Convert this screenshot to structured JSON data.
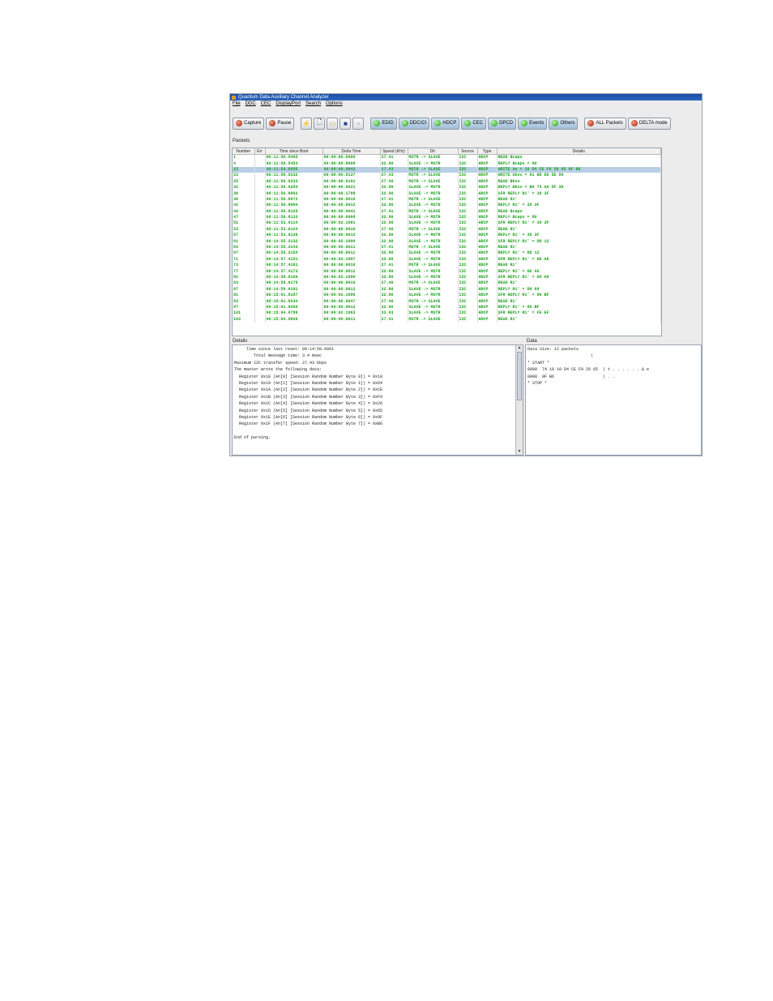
{
  "window": {
    "title": "Quantum Data Auxiliary Channel Analyzer"
  },
  "menu": [
    "File",
    "DDC",
    "CEC",
    "DisplayPort",
    "Search",
    "Options"
  ],
  "toolbar": {
    "capture": "Capture",
    "pause": "Pause",
    "filters": [
      "EDID",
      "DDC/CI",
      "HDCP",
      "CEC",
      "DPCD",
      "Events",
      "Others"
    ],
    "all_packets": "ALL Packets",
    "delta_mode": "DELTA mode"
  },
  "packets": {
    "label": "Packets",
    "columns": [
      "Number",
      "Err",
      "Time since Boot",
      "Delta Time",
      "Speed (kHz)",
      "Dir",
      "Source",
      "Type",
      "Details"
    ],
    "rows": [
      [
        "1",
        "",
        "00:11:50.5465",
        "00:00:00.0000",
        "27.41",
        "MSTR -> SLAVE",
        "I2C",
        "HDCP",
        "READ Bcaps"
      ],
      [
        "4",
        "",
        "00:11:50.5453",
        "00:00:00.0008",
        "32.80",
        "SLAVE -> MSTR",
        "I2C",
        "HDCP",
        "REPLY Bcaps = 80"
      ],
      [
        "15",
        "",
        "00:11:50.6095",
        "00:00:00.0642",
        "27.43",
        "MSTR -> SLAVE",
        "I2C",
        "HDCP",
        "WRITE An = 10 D4 CE F9 26 65 9F B6"
      ],
      [
        "23",
        "",
        "00:11:50.6232",
        "00:00:00.0137",
        "27.43",
        "MSTR -> SLAVE",
        "I2C",
        "HDCP",
        "WRITE Aksv = 61 B8 D0 5E 96"
      ],
      [
        "25",
        "",
        "00:11:50.6233",
        "00:00:00.0101",
        "27.40",
        "MSTR -> SLAVE",
        "I2C",
        "HDCP",
        "READ Bksv"
      ],
      [
        "32",
        "",
        "00:11:50.6254",
        "00:00:00.0021",
        "32.90",
        "SLAVE -> MSTR",
        "I2C",
        "HDCP",
        "REPLY Bksv = B0 75 AA 5F 38"
      ],
      [
        "36",
        "",
        "00:11:50.8062",
        "00:00:00.1798",
        "32.90",
        "SLAVE -> MSTR",
        "I2C",
        "HDCP",
        "SFR REPLY Ri' = 39 3F"
      ],
      [
        "38",
        "",
        "00:11:50.8072",
        "00:00:00.0010",
        "27.41",
        "MSTR -> SLAVE",
        "I2C",
        "HDCP",
        "READ Ri'"
      ],
      [
        "42",
        "",
        "00:11:50.8084",
        "00:00:00.0012",
        "32.90",
        "SLAVE -> MSTR",
        "I2C",
        "HDCP",
        "REPLY Ri' = 39 3F"
      ],
      [
        "44",
        "",
        "00:11:50.8125",
        "00:00:00.0041",
        "27.41",
        "MSTR -> SLAVE",
        "I2C",
        "HDCP",
        "READ Bcaps"
      ],
      [
        "47",
        "",
        "00:11:50.8133",
        "00:00:00.0008",
        "32.90",
        "SLAVE -> MSTR",
        "I2C",
        "HDCP",
        "REPLY Bcaps = 80"
      ],
      [
        "51",
        "",
        "00:11:53.0114",
        "00:00:02.1981",
        "32.90",
        "SLAVE -> MSTR",
        "I2C",
        "HDCP",
        "SFR REPLY Ri' = 39 3F"
      ],
      [
        "53",
        "",
        "00:11:53.0124",
        "00:00:00.0010",
        "27.40",
        "MSTR -> SLAVE",
        "I2C",
        "HDCP",
        "READ Ri'"
      ],
      [
        "57",
        "",
        "00:11:53.0136",
        "00:00:00.0012",
        "32.90",
        "SLAVE -> MSTR",
        "I2C",
        "HDCP",
        "REPLY Ri' = 39 3F"
      ],
      [
        "61",
        "",
        "00:14:55.2132",
        "00:00:02.1996",
        "32.90",
        "SLAVE -> MSTR",
        "I2C",
        "HDCP",
        "SFR REPLY Ri' = DD 12"
      ],
      [
        "63",
        "",
        "00:14:55.2143",
        "00:00:00.0011",
        "27.41",
        "MSTR -> SLAVE",
        "I2C",
        "HDCP",
        "READ Ri'"
      ],
      [
        "67",
        "",
        "00:14:55.2154",
        "00:00:00.0011",
        "32.90",
        "SLAVE -> MSTR",
        "I2C",
        "HDCP",
        "REPLY Ri' = DD 12"
      ],
      [
        "71",
        "",
        "00:14:57.4151",
        "00:00:02.1997",
        "32.80",
        "SLAVE -> MSTR",
        "I2C",
        "HDCP",
        "SFR REPLY Ri' = DE A6"
      ],
      [
        "73",
        "",
        "00:14:57.4161",
        "00:00:00.0010",
        "27.41",
        "MSTR -> SLAVE",
        "I2C",
        "HDCP",
        "READ Ri'"
      ],
      [
        "77",
        "",
        "00:14:57.4173",
        "00:00:00.0012",
        "32.80",
        "SLAVE -> MSTR",
        "I2C",
        "HDCP",
        "REPLY Ri' = DE A6"
      ],
      [
        "81",
        "",
        "00:14:59.6169",
        "00:00:02.1996",
        "32.90",
        "SLAVE -> MSTR",
        "I2C",
        "HDCP",
        "SFR REPLY Ri' = D6 69"
      ],
      [
        "83",
        "",
        "00:14:59.6179",
        "00:00:00.0010",
        "27.40",
        "MSTR -> SLAVE",
        "I2C",
        "HDCP",
        "READ Ri'"
      ],
      [
        "87",
        "",
        "00:14:59.6191",
        "00:00:00.0012",
        "32.80",
        "SLAVE -> MSTR",
        "I2C",
        "HDCP",
        "REPLY Ri' = D6 69"
      ],
      [
        "91",
        "",
        "00:15:01.8187",
        "00:00:02.1996",
        "32.90",
        "SLAVE -> MSTR",
        "I2C",
        "HDCP",
        "SFR REPLY Ri' = 86 BF"
      ],
      [
        "93",
        "",
        "00:15:01.8234",
        "00:00:00.0047",
        "27.40",
        "MSTR -> SLAVE",
        "I2C",
        "HDCP",
        "READ Ri'"
      ],
      [
        "97",
        "",
        "00:15:01.8266",
        "00:00:00.0012",
        "32.90",
        "SLAVE -> MSTR",
        "I2C",
        "HDCP",
        "REPLY Ri' = 86 BF"
      ],
      [
        "101",
        "",
        "00:15:04.0789",
        "00:00:02.1963",
        "33.03",
        "SLAVE -> MSTR",
        "I2C",
        "HDCP",
        "SFR REPLY Ri' = FE EF"
      ],
      [
        "103",
        "",
        "00:15:04.0820",
        "00:00:00.0011",
        "27.41",
        "MSTR -> SLAVE",
        "I2C",
        "HDCP",
        "READ Ri'"
      ]
    ],
    "selected_row": 2
  },
  "details": {
    "label": "Details",
    "text": "     Time since last reset: 00:14:50.6061\n        Total message time: 3.4 msec\nMaximum I2C transfer speed: 27.43 kbps\nThe master wrote the following data:\n  Register 0x18 (An[0] [Session Random Number Byte 0]) = 0x10\n  Register 0x19 (An[1] [Session Random Number Byte 1]) = 0xD4\n  Register 0x1A (An[2] [Session Random Number Byte 2]) = 0xCE\n  Register 0x1B (An[3] [Session Random Number Byte 3]) = 0xF9\n  Register 0x1C (An[4] [Session Random Number Byte 4]) = 0x26\n  Register 0x1D (An[5] [Session Random Number Byte 5]) = 0x65\n  Register 0x1E (An[6] [Session Random Number Byte 6]) = 0x9F\n  Register 0x1F (An[7] [Session Random Number Byte 7]) = 0xB6\n\nEnd of parsing."
  },
  "data_panel": {
    "label": "Data",
    "text": "Data Size: 12 packets\n                          |\n* START *\n0000  74 18 10 D4 CE F9 26 65  | t . . . . . . & e\n0008  9F B6                    | . .\n* STOP *"
  }
}
